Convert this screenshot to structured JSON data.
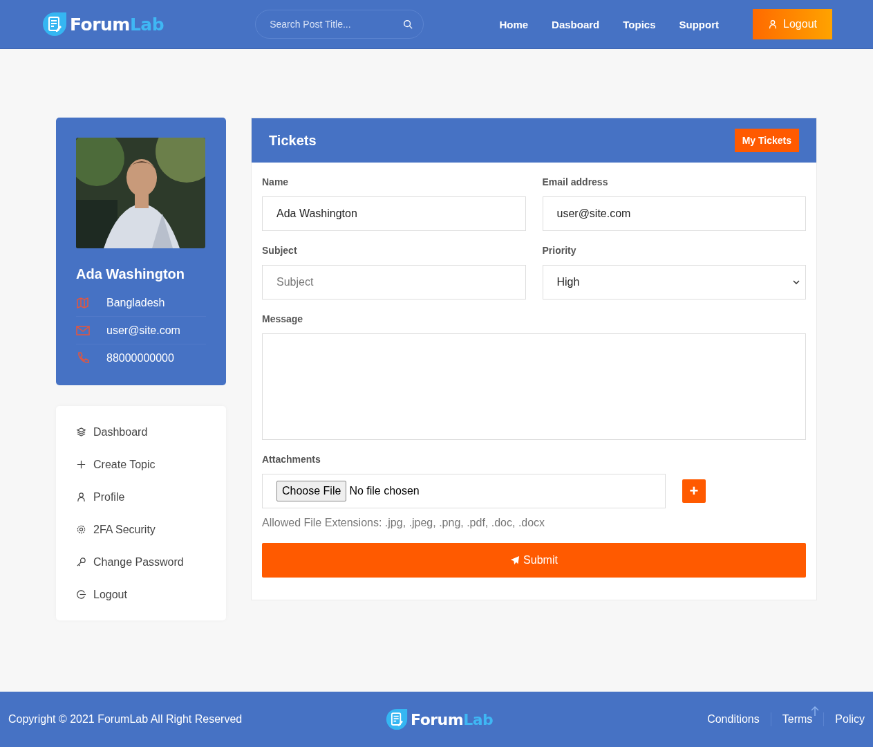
{
  "header": {
    "logo": {
      "primary": "Forum",
      "accent": "Lab"
    },
    "search": {
      "placeholder": "Search Post Title..."
    },
    "nav": [
      {
        "label": "Home"
      },
      {
        "label": "Dasboard"
      },
      {
        "label": "Topics"
      },
      {
        "label": "Support"
      }
    ],
    "logout_button": "Logout"
  },
  "profile": {
    "name": "Ada Washington",
    "details": [
      {
        "kind": "location",
        "text": "Bangladesh"
      },
      {
        "kind": "email",
        "text": "user@site.com"
      },
      {
        "kind": "phone",
        "text": "88000000000"
      }
    ]
  },
  "menu": [
    {
      "kind": "dashboard",
      "label": "Dashboard"
    },
    {
      "kind": "create",
      "label": "Create Topic"
    },
    {
      "kind": "profile",
      "label": "Profile"
    },
    {
      "kind": "security",
      "label": "2FA Security"
    },
    {
      "kind": "password",
      "label": "Change Password"
    },
    {
      "kind": "logout",
      "label": "Logout"
    }
  ],
  "tickets": {
    "title": "Tickets",
    "my_tickets_button": "My Tickets",
    "name": {
      "label": "Name",
      "value": "Ada Washington"
    },
    "email": {
      "label": "Email address",
      "value": "user@site.com"
    },
    "subject": {
      "label": "Subject",
      "placeholder": "Subject"
    },
    "priority": {
      "label": "Priority",
      "value": "High"
    },
    "message": {
      "label": "Message"
    },
    "attachments": {
      "label": "Attachments",
      "choose_button": "Choose File",
      "status": "No file chosen",
      "add_button": "+",
      "hint": "Allowed File Extensions: .jpg, .jpeg, .png, .pdf, .doc, .docx"
    },
    "submit_button": "Submit"
  },
  "footer": {
    "copyright": "Copyright © 2021 ForumLab All Right Reserved",
    "logo": {
      "primary": "Forum",
      "accent": "Lab"
    },
    "links": [
      {
        "label": "Conditions"
      },
      {
        "label": "Terms"
      },
      {
        "label": "Policy"
      }
    ]
  }
}
